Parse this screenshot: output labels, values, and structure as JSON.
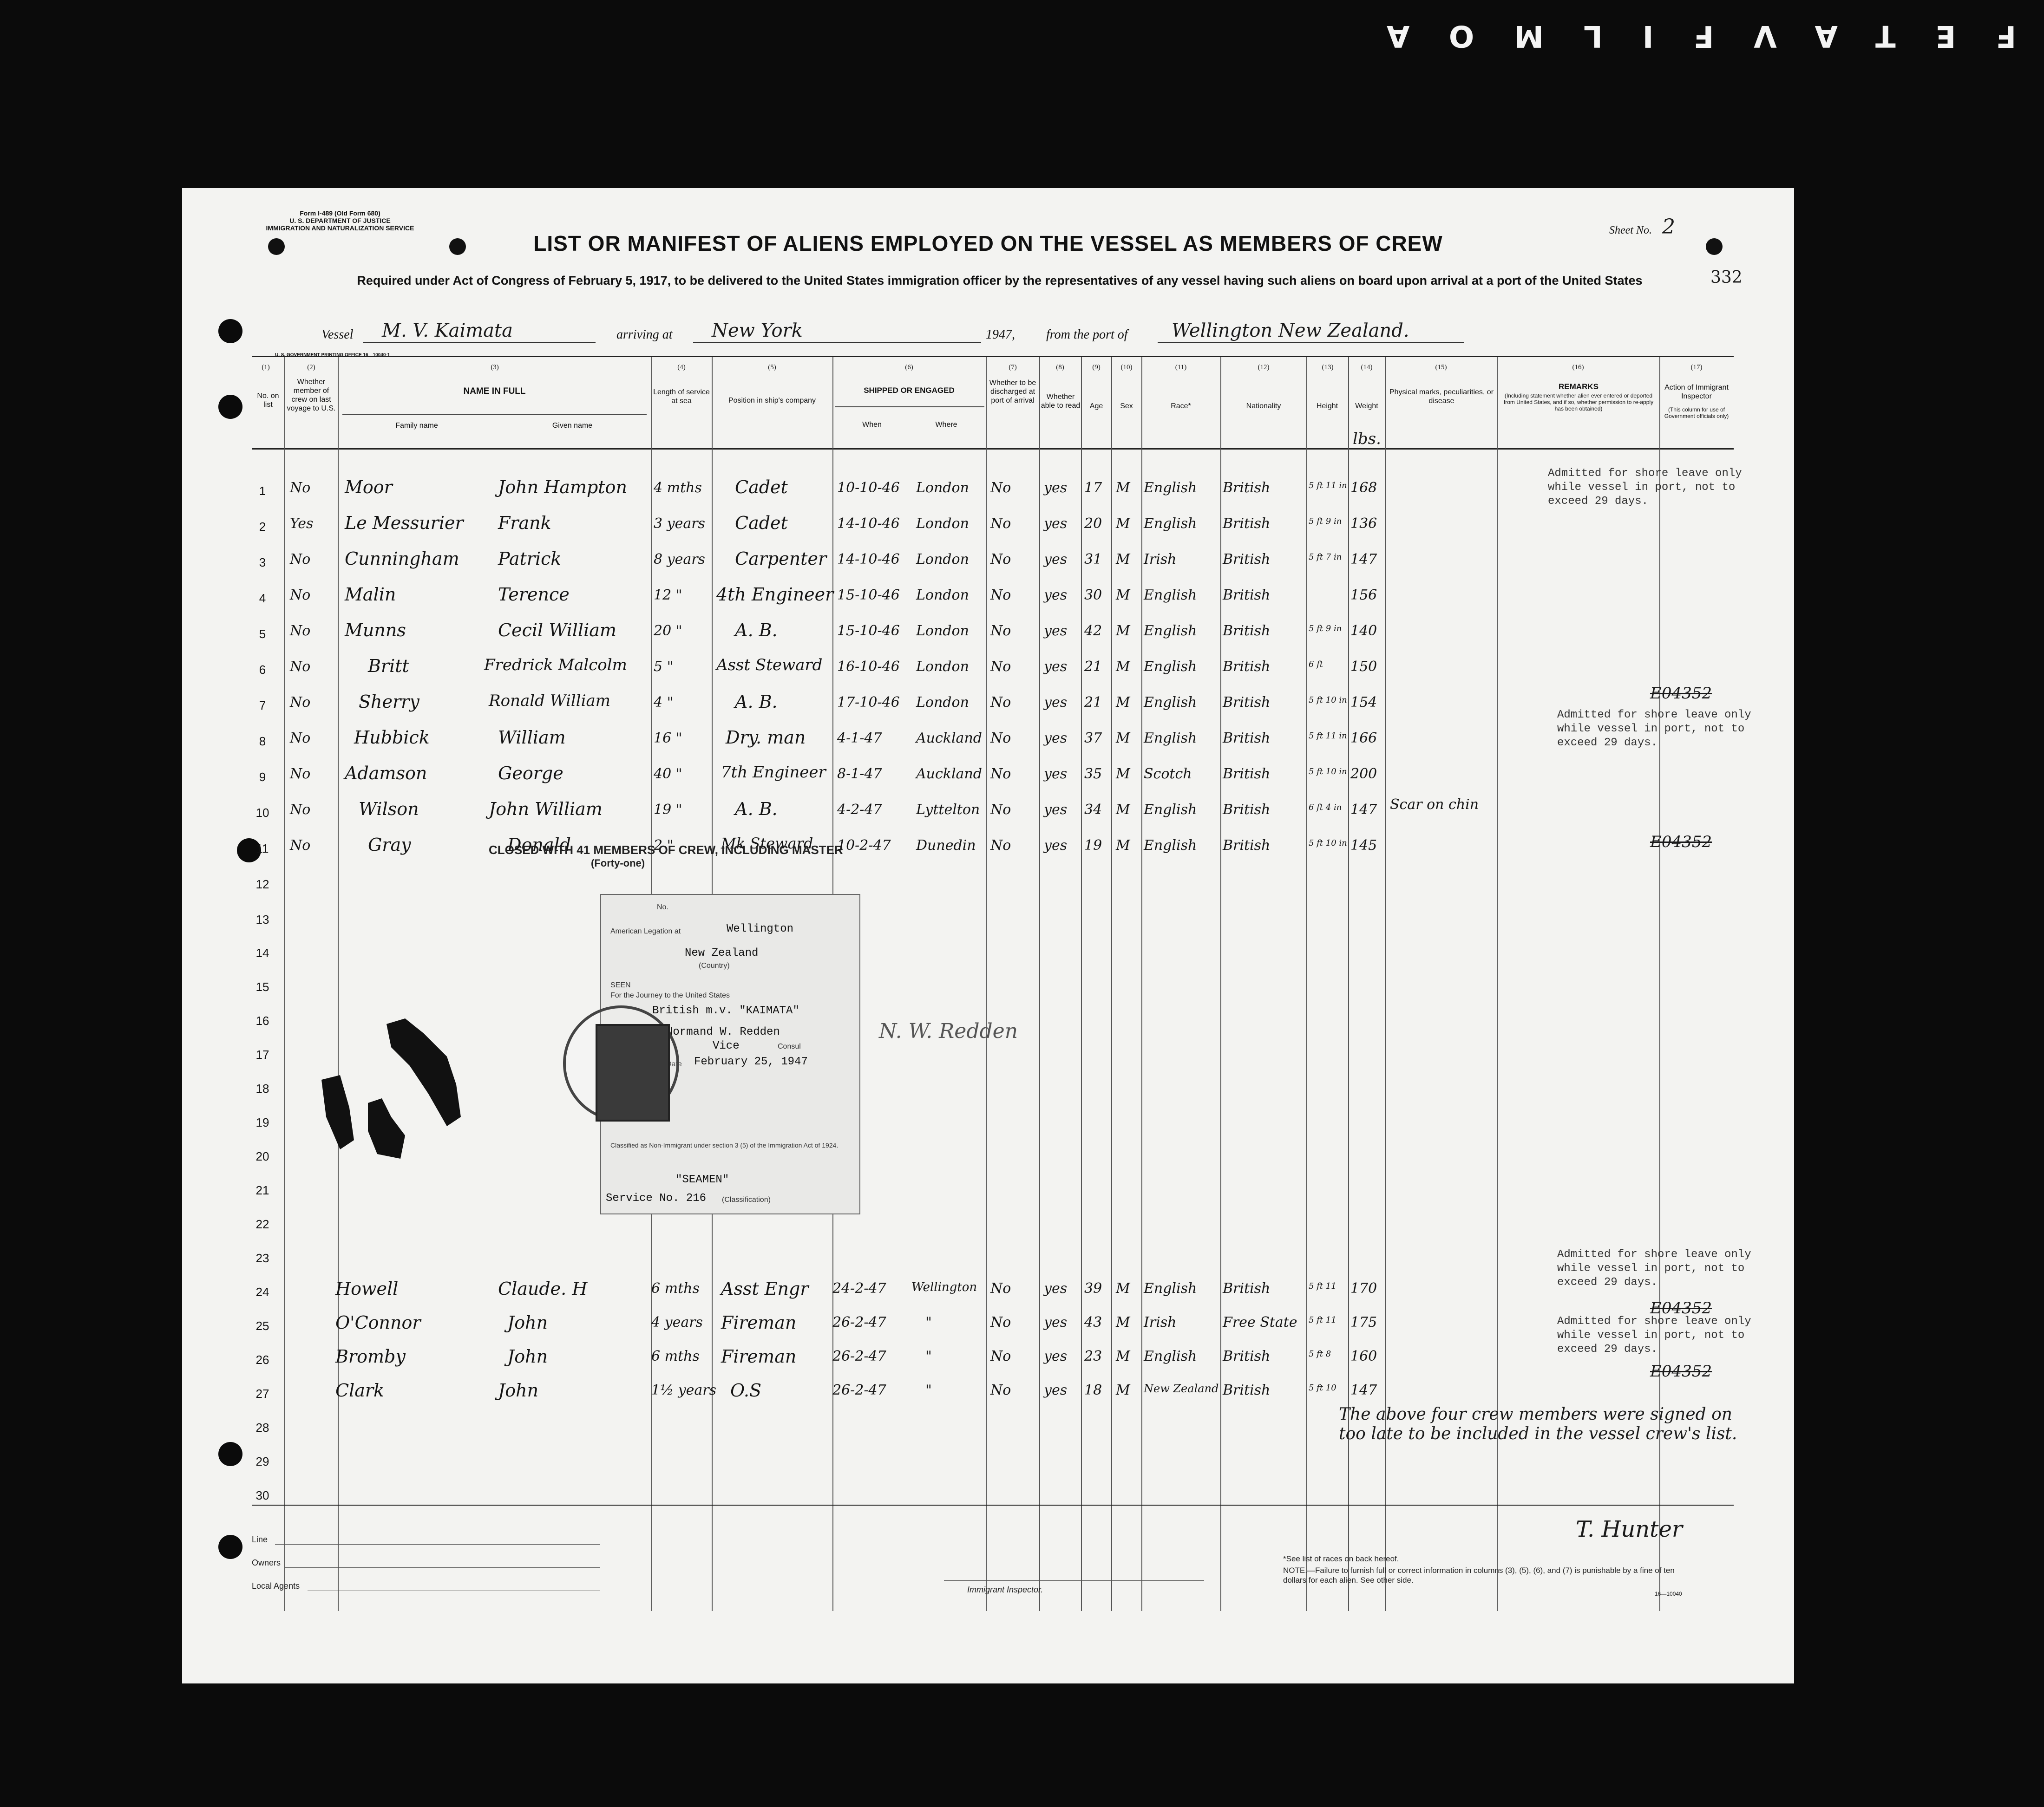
{
  "film_mark": "FETAVFILMOA",
  "form_id": [
    "Form I-489 (Old Form 680)",
    "U. S. DEPARTMENT OF JUSTICE",
    "IMMIGRATION AND NATURALIZATION SERVICE"
  ],
  "sheet_label": "Sheet No.",
  "sheet_no": "2",
  "title": "LIST OR MANIFEST OF ALIENS EMPLOYED ON THE VESSEL AS MEMBERS OF CREW",
  "subtitle": "Required under Act of Congress of February 5, 1917, to be delivered to the United States immigration officer by the representatives of any vessel having such aliens on board upon arrival at a port of the United States",
  "page_code": "332",
  "vessel": {
    "vessel_label": "Vessel",
    "vessel_name": "M. V. Kaimata",
    "arriving_label": "arriving at",
    "arriving_at": "New York",
    "year": "1947,",
    "from_label": "from the port of",
    "from_port": "Wellington New Zealand."
  },
  "printer": "U. S. GOVERNMENT PRINTING OFFICE 16—10040-1",
  "columns": {
    "numbers": [
      "(1)",
      "(2)",
      "(3)",
      "(4)",
      "(5)",
      "(6)",
      "(7)",
      "(8)",
      "(9)",
      "(10)",
      "(11)",
      "(12)",
      "(13)",
      "(14)",
      "(15)",
      "(16)",
      "(17)"
    ],
    "no_on_list": "No. on list",
    "whether_member": "Whether member of crew on last voyage to U.S.",
    "name_in_full": "NAME IN FULL",
    "family_name": "Family name",
    "given_name": "Given name",
    "length_service": "Length of service at sea",
    "position": "Position in ship's company",
    "shipped": "SHIPPED OR ENGAGED",
    "when": "When",
    "where": "Where",
    "discharged": "Whether to be discharged at port of arrival",
    "able_to_read": "Whether able to read",
    "age": "Age",
    "sex": "Sex",
    "race": "Race*",
    "nationality": "Nationality",
    "height": "Height",
    "weight": "Weight",
    "physical_marks": "Physical marks, peculiarities, or disease",
    "remarks": "REMARKS",
    "remarks_note": "(Including statement whether alien ever entered or deported from United States, and if so, whether permission to re-apply has been obtained)",
    "action": "Action of Immigrant Inspector",
    "action_note": "(This column for use of Government officials only)",
    "weight_unit": "lbs."
  },
  "crew": [
    {
      "no": "1",
      "last": "No",
      "family": "Moor",
      "given": "John Hampton",
      "service": "4 mths",
      "position": "Cadet",
      "when": "10-10-46",
      "where": "London",
      "disch": "No",
      "read": "yes",
      "age": "17",
      "sex": "M",
      "race": "English",
      "nat": "British",
      "height": "5 ft 11 in",
      "weight": "168"
    },
    {
      "no": "2",
      "last": "Yes",
      "family": "Le Messurier",
      "given": "Frank",
      "service": "3 years",
      "position": "Cadet",
      "when": "14-10-46",
      "where": "London",
      "disch": "No",
      "read": "yes",
      "age": "20",
      "sex": "M",
      "race": "English",
      "nat": "British",
      "height": "5 ft 9 in",
      "weight": "136"
    },
    {
      "no": "3",
      "last": "No",
      "family": "Cunningham",
      "given": "Patrick",
      "service": "8 years",
      "position": "Carpenter",
      "when": "14-10-46",
      "where": "London",
      "disch": "No",
      "read": "yes",
      "age": "31",
      "sex": "M",
      "race": "Irish",
      "nat": "British",
      "height": "5 ft 7 in",
      "weight": "147"
    },
    {
      "no": "4",
      "last": "No",
      "family": "Malin",
      "given": "Terence",
      "service": "12 \"",
      "position": "4th Engineer",
      "when": "15-10-46",
      "where": "London",
      "disch": "No",
      "read": "yes",
      "age": "30",
      "sex": "M",
      "race": "English",
      "nat": "British",
      "height": "",
      "weight": "156"
    },
    {
      "no": "5",
      "last": "No",
      "family": "Munns",
      "given": "Cecil William",
      "service": "20 \"",
      "position": "A. B.",
      "when": "15-10-46",
      "where": "London",
      "disch": "No",
      "read": "yes",
      "age": "42",
      "sex": "M",
      "race": "English",
      "nat": "British",
      "height": "5 ft 9 in",
      "weight": "140"
    },
    {
      "no": "6",
      "last": "No",
      "family": "Britt",
      "given": "Fredrick Malcolm",
      "service": "5 \"",
      "position": "Asst Steward",
      "when": "16-10-46",
      "where": "London",
      "disch": "No",
      "read": "yes",
      "age": "21",
      "sex": "M",
      "race": "English",
      "nat": "British",
      "height": "6 ft",
      "weight": "150"
    },
    {
      "no": "7",
      "last": "No",
      "family": "Sherry",
      "given": "Ronald William",
      "service": "4 \"",
      "position": "A. B.",
      "when": "17-10-46",
      "where": "London",
      "disch": "No",
      "read": "yes",
      "age": "21",
      "sex": "M",
      "race": "English",
      "nat": "British",
      "height": "5 ft 10 in",
      "weight": "154"
    },
    {
      "no": "8",
      "last": "No",
      "family": "Hubbick",
      "given": "William",
      "service": "16 \"",
      "position": "Dry. man",
      "when": "4-1-47",
      "where": "Auckland",
      "disch": "No",
      "read": "yes",
      "age": "37",
      "sex": "M",
      "race": "English",
      "nat": "British",
      "height": "5 ft 11 in",
      "weight": "166"
    },
    {
      "no": "9",
      "last": "No",
      "family": "Adamson",
      "given": "George",
      "service": "40 \"",
      "position": "7th Engineer",
      "when": "8-1-47",
      "where": "Auckland",
      "disch": "No",
      "read": "yes",
      "age": "35",
      "sex": "M",
      "race": "Scotch",
      "nat": "British",
      "height": "5 ft 10 in",
      "weight": "200"
    },
    {
      "no": "10",
      "last": "No",
      "family": "Wilson",
      "given": "John William",
      "service": "19 \"",
      "position": "A. B.",
      "when": "4-2-47",
      "where": "Lyttelton",
      "disch": "No",
      "read": "yes",
      "age": "34",
      "sex": "M",
      "race": "English",
      "nat": "British",
      "height": "6 ft 4 in",
      "weight": "147",
      "marks": "Scar on chin"
    },
    {
      "no": "11",
      "last": "No",
      "family": "Gray",
      "given": "Donald",
      "service": "2 \"",
      "position": "Mk Steward",
      "when": "10-2-47",
      "where": "Dunedin",
      "disch": "No",
      "read": "yes",
      "age": "19",
      "sex": "M",
      "race": "English",
      "nat": "British",
      "height": "5 ft 10 in",
      "weight": "145"
    }
  ],
  "crew_late": [
    {
      "no": "24",
      "family": "Howell",
      "given": "Claude. H",
      "service": "6 mths",
      "position": "Asst Engr",
      "when": "24-2-47",
      "where": "Wellington",
      "disch": "No",
      "read": "yes",
      "age": "39",
      "sex": "M",
      "race": "English",
      "nat": "British",
      "height": "5 ft 11",
      "weight": "170"
    },
    {
      "no": "25",
      "family": "O'Connor",
      "given": "John",
      "service": "4 years",
      "position": "Fireman",
      "when": "26-2-47",
      "where": "\"",
      "disch": "No",
      "read": "yes",
      "age": "43",
      "sex": "M",
      "race": "Irish",
      "nat": "Free State",
      "height": "5 ft 11",
      "weight": "175"
    },
    {
      "no": "26",
      "family": "Bromby",
      "given": "John",
      "service": "6 mths",
      "position": "Fireman",
      "when": "26-2-47",
      "where": "\"",
      "disch": "No",
      "read": "yes",
      "age": "23",
      "sex": "M",
      "race": "English",
      "nat": "British",
      "height": "5 ft 8",
      "weight": "160"
    },
    {
      "no": "27",
      "family": "Clark",
      "given": "John",
      "service": "1½ years",
      "position": "O.S",
      "when": "26-2-47",
      "where": "\"",
      "disch": "No",
      "read": "yes",
      "age": "18",
      "sex": "M",
      "race": "New Zealand",
      "nat": "British",
      "height": "5 ft 10",
      "weight": "147"
    }
  ],
  "empty_rows": [
    "12",
    "13",
    "14",
    "15",
    "16",
    "17",
    "18",
    "19",
    "20",
    "21",
    "22",
    "23",
    "28",
    "29",
    "30"
  ],
  "remarks_stamp": [
    "Admitted for shore leave only",
    "while vessel in port, not to",
    "exceed 29 days."
  ],
  "inspector_code": "E04352",
  "closed_with": "CLOSED WITH 41 MEMBERS OF CREW, INCLUDING MASTER",
  "closed_sub": "(Forty-one)",
  "visa": {
    "no_label": "No.",
    "legation_label": "American Legation at",
    "legation_city": "Wellington",
    "country": "New Zealand",
    "country_label": "(Country)",
    "seen_label": "SEEN",
    "journey_label": "For the Journey to the United States",
    "ship": "British m.v. \"KAIMATA\"",
    "officer": "Normand W. Redden",
    "officer_title": "Vice",
    "consul_label": "Consul",
    "date_label": "Date",
    "date": "February 25, 1947",
    "classified": "Classified as Non-Immigrant under section 3 (5) of the Immigration Act of 1924.",
    "class": "\"SEAMEN\"",
    "service": "Service No. 216",
    "class_label": "(Classification)"
  },
  "late_note": "The above four crew members were signed on too late to be included in the vessel crew's list.",
  "footer": {
    "line": "Line",
    "owners": "Owners",
    "agents": "Local Agents",
    "inspector": "Immigrant Inspector.",
    "races_note": "*See list of races on back hereof.",
    "note": "NOTE.—Failure to furnish full or correct information in columns (3), (5), (6), and (7) is punishable by a fine of ten dollars for each alien. See other side.",
    "code": "16—10040"
  },
  "colors": {
    "film": "#0b0b0b",
    "paper": "#f3f3f1",
    "ink": "#141414"
  }
}
